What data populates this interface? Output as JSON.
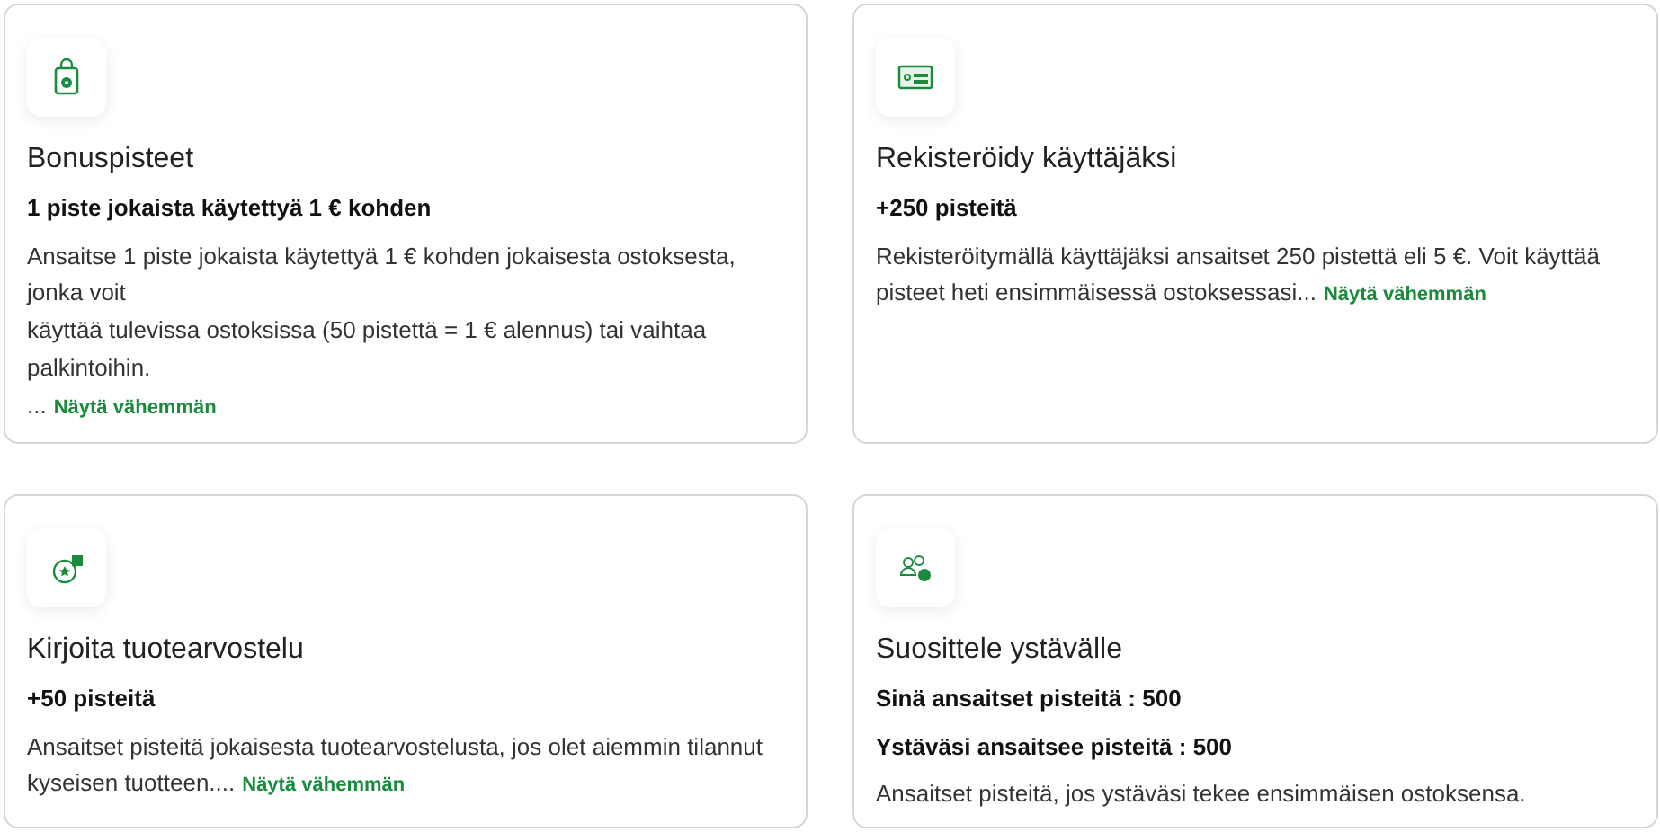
{
  "cards": [
    {
      "title": "Bonuspisteet",
      "highlights": [
        "1 piste jokaista käytettyä 1 € kohden"
      ],
      "description": [
        "Ansaitse 1 piste jokaista käytettyä 1 € kohden jokaisesta ostoksesta, jonka voit",
        "käyttää tulevissa ostoksissa (50 pistettä = 1 € alennus) tai vaihtaa palkintoihin.",
        "..."
      ],
      "link": "Näytä vähemmän"
    },
    {
      "title": "Rekisteröidy käyttäjäksi",
      "highlights": [
        "+250 pisteitä"
      ],
      "description": [
        "Rekisteröitymällä käyttäjäksi ansaitset 250 pistettä eli 5 €. Voit käyttää pisteet heti ensimmäisessä ostoksessasi..."
      ],
      "link": "Näytä vähemmän"
    },
    {
      "title": "Kirjoita tuotearvostelu",
      "highlights": [
        "+50 pisteitä"
      ],
      "description": [
        "Ansaitset pisteitä jokaisesta tuotearvostelusta, jos olet aiemmin tilannut kyseisen tuotteen...."
      ],
      "link": "Näytä vähemmän"
    },
    {
      "title": "Suosittele ystävälle",
      "highlights": [
        "Sinä ansaitset pisteitä : 500",
        "Ystäväsi ansaitsee pisteitä : 500"
      ],
      "description": [
        "Ansaitset pisteitä, jos ystäväsi tekee ensimmäisen ostoksensa."
      ]
    }
  ]
}
